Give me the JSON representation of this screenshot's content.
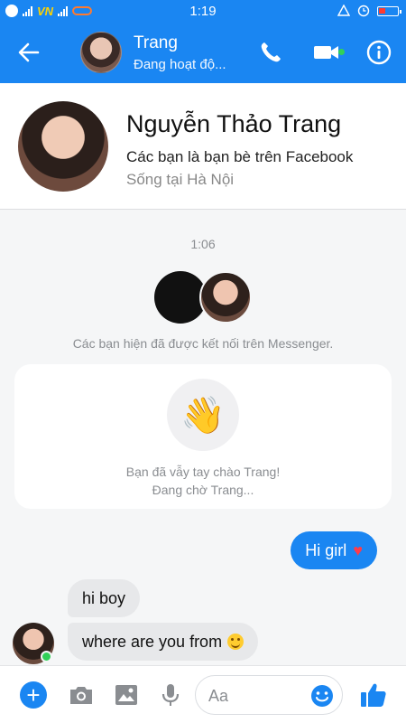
{
  "status_bar": {
    "time": "1:19",
    "carrier": "VN",
    "icons": [
      "messenger-icon",
      "signal-icon",
      "carrier-logo",
      "signal-icon",
      "vietnamobile-icon",
      "alarm-icon",
      "clock-icon",
      "battery-icon"
    ]
  },
  "header": {
    "contact_name": "Trang",
    "status": "Đang hoạt độ...",
    "icons": [
      "back-arrow-icon",
      "phone-icon",
      "video-camera-icon",
      "info-icon"
    ],
    "accent_color": "#1a86f2"
  },
  "profile": {
    "full_name": "Nguyễn Thảo Trang",
    "friends_text": "Các bạn là bạn bè trên Facebook",
    "lives_in": "Sống tại Hà Nội"
  },
  "chat": {
    "timestamp": "1:06",
    "connected_text": "Các bạn hiện đã được kết nối trên Messenger.",
    "wave": {
      "emoji": "👋",
      "line1": "Bạn đã vẫy tay chào Trang!",
      "line2": "Đang chờ Trang..."
    },
    "messages": [
      {
        "from": "me",
        "text": "Hi girl",
        "emoji": "❤️"
      },
      {
        "from": "them",
        "text": "hi boy"
      },
      {
        "from": "them",
        "text": "where are you from",
        "emoji": "🙂"
      }
    ]
  },
  "composer": {
    "placeholder": "Aa",
    "icons": [
      "plus-icon",
      "camera-icon",
      "image-icon",
      "microphone-icon",
      "emoji-icon",
      "thumbs-up-icon"
    ]
  }
}
